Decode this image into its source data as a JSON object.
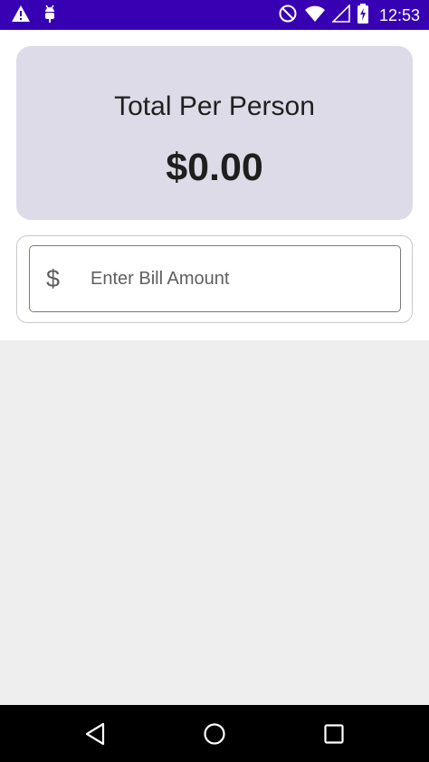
{
  "status_bar": {
    "time": "12:53",
    "left_icons": [
      "warning-icon",
      "android-debug-icon"
    ],
    "right_icons": [
      "do-not-disturb-icon",
      "wifi-icon",
      "cell-signal-icon",
      "battery-charging-icon"
    ]
  },
  "total_card": {
    "label": "Total Per Person",
    "amount": "$0.00"
  },
  "bill_input": {
    "prefix": "$",
    "value": "",
    "placeholder": "Enter Bill Amount"
  },
  "nav_bar": {
    "buttons": [
      "back-icon",
      "home-icon",
      "recents-icon"
    ]
  },
  "colors": {
    "status_bar": "#3700b3",
    "card_background": "#dddbe7",
    "page_background": "#eeeeee"
  }
}
